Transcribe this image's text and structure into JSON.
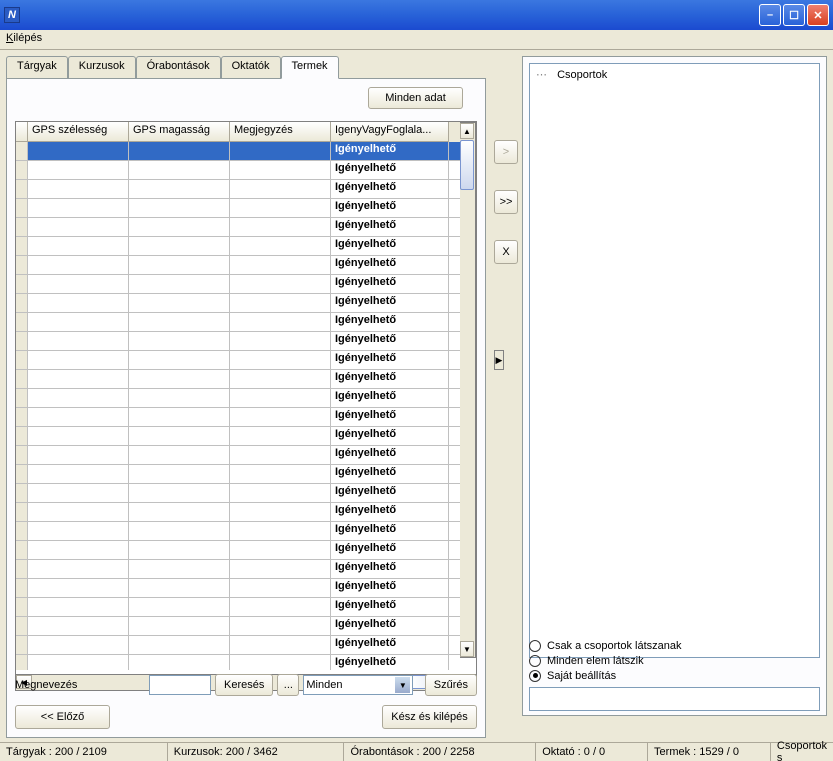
{
  "title": "N",
  "menu": {
    "kilepes": "Kilépés"
  },
  "tabs": [
    "Tárgyak",
    "Kurzusok",
    "Órabontások",
    "Oktatók",
    "Termek"
  ],
  "activeTab": 4,
  "buttons": {
    "minden_adat": "Minden adat",
    "kereses": "Keresés",
    "dots": "...",
    "szures": "Szűrés",
    "elozo": "<< Előző",
    "kesz": "Kész és kilépés"
  },
  "filter": {
    "label": "Megnevezés",
    "select_value": "Minden"
  },
  "grid": {
    "headers": [
      "GPS szélesség",
      "GPS magasság",
      "Megjegyzés",
      "IgenyVagyFoglala..."
    ],
    "rows": [
      {
        "d": "Igényelhető"
      },
      {
        "d": "Igényelhető"
      },
      {
        "d": "Igényelhető"
      },
      {
        "d": "Igényelhető"
      },
      {
        "d": "Igényelhető"
      },
      {
        "d": "Igényelhető"
      },
      {
        "d": "Igényelhető"
      },
      {
        "d": "Igényelhető"
      },
      {
        "d": "Igényelhető"
      },
      {
        "d": "Igényelhető"
      },
      {
        "d": "Igényelhető"
      },
      {
        "d": "Igényelhető"
      },
      {
        "d": "Igényelhető"
      },
      {
        "d": "Igényelhető"
      },
      {
        "d": "Igényelhető"
      },
      {
        "d": "Igényelhető"
      },
      {
        "d": "Igényelhető"
      },
      {
        "d": "Igényelhető"
      },
      {
        "d": "Igényelhető"
      },
      {
        "d": "Igényelhető"
      },
      {
        "d": "Igényelhető"
      },
      {
        "d": "Igényelhető"
      },
      {
        "d": "Igényelhető"
      },
      {
        "d": "Igényelhető"
      },
      {
        "d": "Igényelhető"
      },
      {
        "d": "Igényelhető"
      },
      {
        "d": "Igényelhető"
      },
      {
        "d": "Igényelhető"
      }
    ]
  },
  "transfer": {
    "right": ">",
    "all_right": ">>",
    "remove": "X"
  },
  "right": {
    "tree_root": "Csoportok",
    "radios": [
      "Csak a csoportok látszanak",
      "Minden elem látszik",
      "Saját beállítás"
    ],
    "radio_selected": 2
  },
  "status": {
    "targyak": "Tárgyak : 200 / 2109",
    "kurzusok": "Kurzusok: 200 / 3462",
    "orabontasok": "Órabontások : 200 / 2258",
    "oktato": "Oktató : 0 / 0",
    "termek": "Termek : 1529 / 0",
    "csoportok": "Csoportok s"
  }
}
